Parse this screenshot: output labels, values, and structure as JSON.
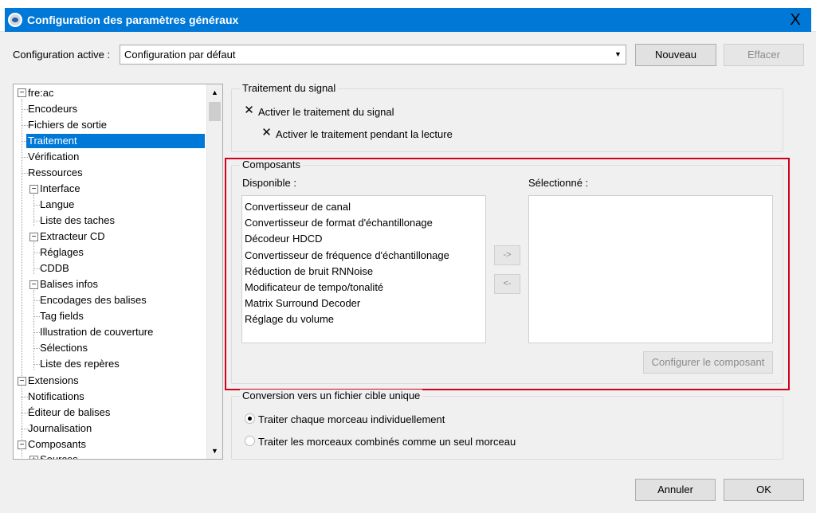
{
  "window": {
    "title": "Configuration des paramètres généraux",
    "close": "X"
  },
  "config": {
    "label": "Configuration active :",
    "value": "Configuration par défaut",
    "new_label": "Nouveau",
    "delete_label": "Effacer"
  },
  "tree": {
    "items": [
      "fre:ac",
      "Encodeurs",
      "Fichiers de sortie",
      "Traitement",
      "Vérification",
      "Ressources",
      "Interface",
      "Langue",
      "Liste des taches",
      "Extracteur CD",
      "Réglages",
      "CDDB",
      "Balises infos",
      "Encodages des balises",
      "Tag fields",
      "Illustration de couverture",
      "Sélections",
      "Liste des repères",
      "Extensions",
      "Notifications",
      "Éditeur de balises",
      "Journalisation",
      "Composants",
      "Sources"
    ],
    "expander_minus": "−",
    "expander_plus": "+"
  },
  "signal": {
    "title": "Traitement du signal",
    "enable": "Activer le traitement du signal",
    "enable_playback": "Activer le traitement pendant la lecture",
    "check_mark": "✕"
  },
  "components": {
    "title": "Composants",
    "available_label": "Disponible :",
    "selected_label": "Sélectionné :",
    "available": [
      "Convertisseur de canal",
      "Convertisseur de format d'échantillonage",
      "Décodeur HDCD",
      "Convertisseur de fréquence d'échantillonage",
      "Réduction de bruit RNNoise",
      "Modificateur de tempo/tonalité",
      "Matrix Surround Decoder",
      "Réglage du volume"
    ],
    "add_label": "->",
    "remove_label": "<-",
    "configure_label": "Configurer le composant"
  },
  "conversion": {
    "title": "Conversion vers un fichier cible unique",
    "option_individual": "Traiter chaque morceau individuellement",
    "option_combined": "Traiter les morceaux combinés comme un seul morceau"
  },
  "footer": {
    "cancel_label": "Annuler",
    "ok_label": "OK"
  },
  "colors": {
    "accent": "#0078d7",
    "highlight": "#d0021b"
  }
}
